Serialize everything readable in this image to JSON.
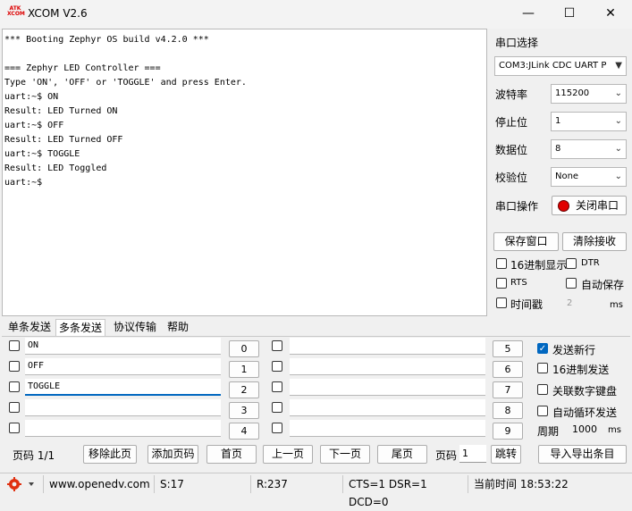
{
  "window": {
    "title": "XCOM V2.6",
    "icon_text": "ATK XCOM",
    "minimize": "—",
    "maximize": "☐",
    "close": "✕"
  },
  "console": {
    "lines": [
      "*** Booting Zephyr OS build v4.2.0 ***",
      "",
      "=== Zephyr LED Controller ===",
      "Type 'ON', 'OFF' or 'TOGGLE' and press Enter.",
      "uart:~$ ON",
      "Result: LED Turned ON",
      "uart:~$ OFF",
      "Result: LED Turned OFF",
      "uart:~$ TOGGLE",
      "Result: LED Toggled",
      "uart:~$"
    ]
  },
  "serial": {
    "port_label": "串口选择",
    "port_value": "COM3:JLink CDC UART P",
    "baud_label": "波特率",
    "baud_value": "115200",
    "stop_label": "停止位",
    "stop_value": "1",
    "data_label": "数据位",
    "data_value": "8",
    "parity_label": "校验位",
    "parity_value": "None",
    "op_label": "串口操作",
    "close_port": "关闭串口",
    "status_color": "#e00000"
  },
  "actions": {
    "save_window": "保存窗口",
    "clear_recv": "清除接收"
  },
  "options": {
    "hex_display": "16进制显示",
    "dtr": "DTR",
    "rts": "RTS",
    "auto_save": "自动保存",
    "timestamp": "时间戳",
    "timestamp_value": "2",
    "timestamp_unit": "ms"
  },
  "tabs": [
    "单条发送",
    "多条发送",
    "协议传输",
    "帮助"
  ],
  "multi_send": {
    "left_values": [
      "ON",
      "OFF",
      "TOGGLE",
      "",
      ""
    ],
    "left_numbers": [
      "0",
      "1",
      "2",
      "3",
      "4"
    ],
    "right_values": [
      "",
      "",
      "",
      "",
      ""
    ],
    "right_numbers": [
      "5",
      "6",
      "7",
      "8",
      "9"
    ]
  },
  "send_options": {
    "send_newline": "发送新行",
    "hex_send": "16进制发送",
    "numpad": "关联数字键盘",
    "auto_loop": "自动循环发送",
    "period_label": "周期",
    "period_value": "1000",
    "period_unit": "ms"
  },
  "pager": {
    "page_code": "页码 1/1",
    "remove_page": "移除此页",
    "add_page": "添加页码",
    "first": "首页",
    "prev": "上一页",
    "next": "下一页",
    "last": "尾页",
    "page_label": "页码",
    "page_value": "1",
    "jump": "跳转",
    "import_export": "导入导出条目"
  },
  "status": {
    "url": "www.openedv.com",
    "sent": "S:17",
    "received": "R:237",
    "signals": "CTS=1 DSR=1 DCD=0",
    "time": "当前时间 18:53:22"
  }
}
